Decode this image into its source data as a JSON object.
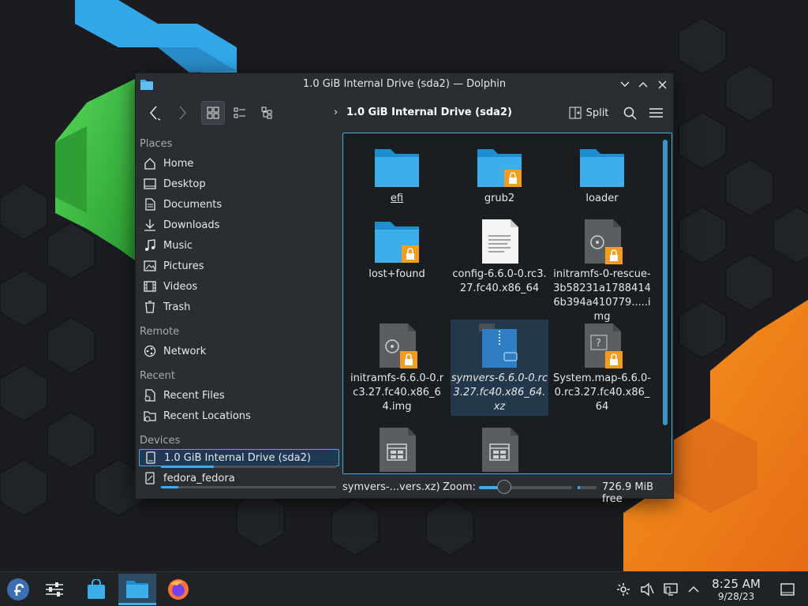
{
  "window": {
    "title": "1.0 GiB Internal Drive (sda2) — Dolphin"
  },
  "toolbar": {
    "breadcrumb": "1.0 GiB Internal Drive (sda2)",
    "split_label": "Split"
  },
  "sidebar": {
    "places_header": "Places",
    "places": [
      {
        "label": "Home",
        "icon": "home-icon"
      },
      {
        "label": "Desktop",
        "icon": "desktop-icon"
      },
      {
        "label": "Documents",
        "icon": "documents-icon"
      },
      {
        "label": "Downloads",
        "icon": "downloads-icon"
      },
      {
        "label": "Music",
        "icon": "music-icon"
      },
      {
        "label": "Pictures",
        "icon": "pictures-icon"
      },
      {
        "label": "Videos",
        "icon": "videos-icon"
      },
      {
        "label": "Trash",
        "icon": "trash-icon"
      }
    ],
    "remote_header": "Remote",
    "remote": [
      {
        "label": "Network",
        "icon": "network-icon"
      }
    ],
    "recent_header": "Recent",
    "recent": [
      {
        "label": "Recent Files",
        "icon": "recent-files-icon"
      },
      {
        "label": "Recent Locations",
        "icon": "recent-locations-icon"
      }
    ],
    "devices_header": "Devices",
    "devices": [
      {
        "label": "1.0 GiB Internal Drive (sda2)",
        "icon": "drive-icon",
        "usage": 0.3
      },
      {
        "label": "fedora_fedora",
        "icon": "drive-icon",
        "usage": 0.1
      }
    ]
  },
  "files": [
    {
      "name": "efi",
      "kind": "folder"
    },
    {
      "name": "grub2",
      "kind": "folder-locked"
    },
    {
      "name": "loader",
      "kind": "folder"
    },
    {
      "name": "lost+found",
      "kind": "folder-locked"
    },
    {
      "name": "config-6.6.0-0.rc3.27.fc40.x86_64",
      "kind": "text"
    },
    {
      "name": "initramfs-0-rescue-3b58231a17884146b394a410779.....img",
      "kind": "disk-image-locked"
    },
    {
      "name": "initramfs-6.6.0-0.rc3.27.fc40.x86_64.img",
      "kind": "disk-image-locked"
    },
    {
      "name": "symvers-6.6.0-0.rc3.27.fc40.x86_64.xz",
      "kind": "archive"
    },
    {
      "name": "System.map-6.6.0-0.rc3.27.fc40.x86_64",
      "kind": "unknown-locked"
    },
    {
      "name": "",
      "kind": "executable"
    },
    {
      "name": "",
      "kind": "executable"
    }
  ],
  "statusbar": {
    "text": "symvers-...vers.xz)",
    "zoom_label": "Zoom:",
    "zoom_level": 0.25,
    "free_space": "726.9 MiB free",
    "used_fraction": 0.1
  },
  "taskbar": {
    "time": "8:25 AM",
    "date": "9/28/23"
  },
  "colors": {
    "accent": "#3daee9",
    "folder": "#3daee9",
    "lock_badge": "#f39c1f",
    "wallpaper_orange": "#f0831f",
    "wallpaper_green": "#3ec53e",
    "wallpaper_blue": "#33a8e8"
  }
}
